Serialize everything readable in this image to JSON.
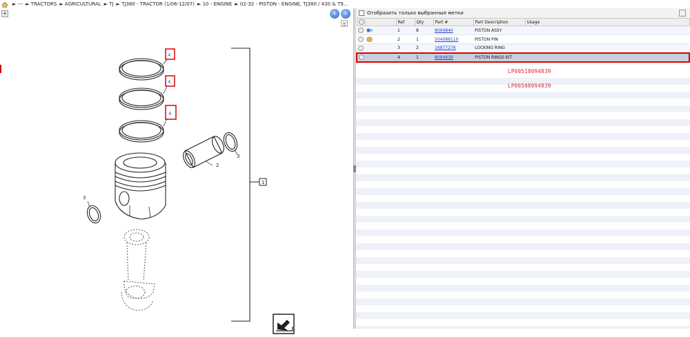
{
  "breadcrumb": {
    "items": [
      "---",
      "TRACTORS",
      "AGRICULTURAL",
      "TJ",
      "TJ380 - TRACTOR (1/06-12/07)",
      "10 - ENGINE",
      "02-32 - PISTON - ENGINE, TJ380 / 430 & T9..."
    ]
  },
  "filter": {
    "label": "Отобразить только выбранные метки"
  },
  "table": {
    "headers": [
      "Ref",
      "Qty",
      "Part #",
      "Part Description",
      "Usage"
    ],
    "rows": [
      {
        "ref": "1",
        "qty": "8",
        "part": "8094840",
        "desc": "PISTON ASSY",
        "usage": "",
        "icon": "piston-icon"
      },
      {
        "ref": "2",
        "qty": "1",
        "part": "504088110",
        "desc": "PISTON PIN",
        "usage": "",
        "icon": "box-icon"
      },
      {
        "ref": "3",
        "qty": "2",
        "part": "16877276",
        "desc": "LOCKING RING",
        "usage": "",
        "icon": ""
      },
      {
        "ref": "4",
        "qty": "1",
        "part": "8094839",
        "desc": "PISTON RINGS KIT",
        "usage": "",
        "icon": ""
      }
    ],
    "selected_index": 3
  },
  "annotations": {
    "lp1": "LP00518094839",
    "lp2": "LP00508094839"
  },
  "diagram": {
    "callouts": {
      "piston_pin": "2",
      "ring_right": "3",
      "ring_left": "3",
      "assembly": "1"
    }
  },
  "colors": {
    "highlight": "#d00000",
    "link": "#1a3fd0",
    "lp_text": "#d22222"
  }
}
